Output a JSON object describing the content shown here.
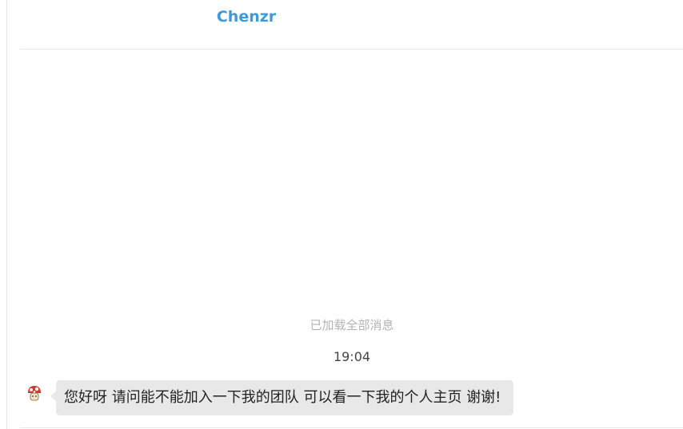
{
  "header": {
    "title": "Chenzr"
  },
  "chat": {
    "loaded_note": "已加载全部消息",
    "timestamp": "19:04",
    "messages": [
      {
        "sender_avatar": "mushroom-icon",
        "text": "您好呀 请问能不能加入一下我的团队 可以看一下我的个人主页 谢谢!"
      }
    ]
  },
  "colors": {
    "title": "#3e9ad6",
    "bubble_bg": "#e8e8e8",
    "muted_text": "#b3b3b3"
  }
}
